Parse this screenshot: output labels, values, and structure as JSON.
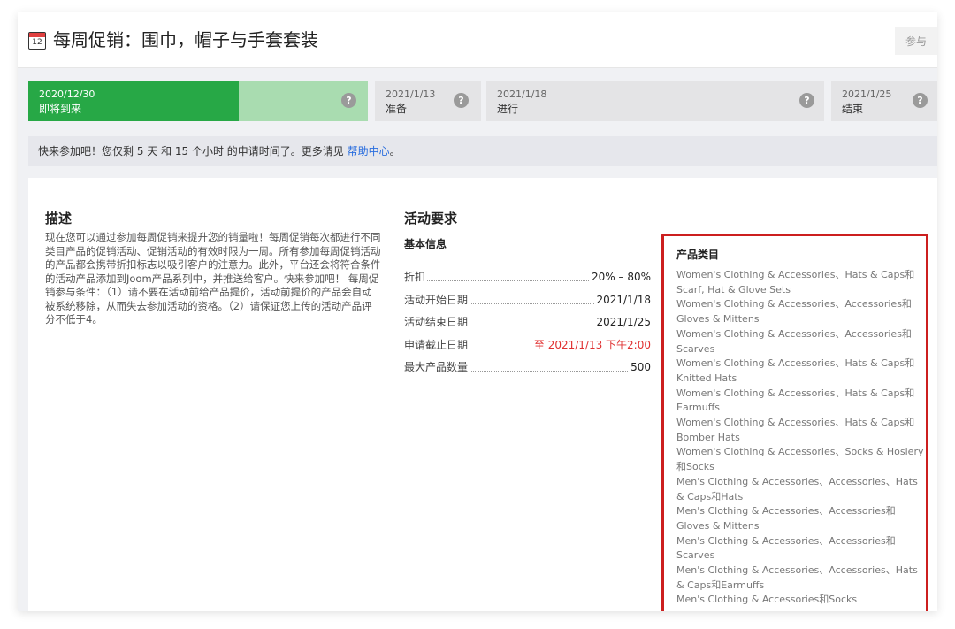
{
  "header": {
    "calendar_day": "12",
    "title": "每周促销：围巾，帽子与手套套装",
    "join_label": "参与"
  },
  "timeline": {
    "stages": [
      {
        "date": "2020/12/30",
        "label": "即将到来",
        "progress": 0.62
      },
      {
        "date": "2021/1/13",
        "label": "准备"
      },
      {
        "date": "2021/1/18",
        "label": "进行"
      },
      {
        "date": "2021/1/25",
        "label": "结束"
      }
    ],
    "help_glyph": "?"
  },
  "notice": {
    "text": "快来参加吧！您仅剩 5 天 和 15 个小时 的申请时间了。更多请见 ",
    "link_label": "帮助中心",
    "suffix": "。",
    "link_color": "#2a6ede"
  },
  "description": {
    "title": "描述",
    "text": "现在您可以通过参加每周促销来提升您的销量啦！每周促销每次都进行不同类目产品的促销活动、促销活动的有效时限为一周。所有参加每周促销活动的产品都会携带折扣标志以吸引客户的注意力。此外，平台还会将符合条件的活动产品添加到Joom产品系列中，并推送给客户。快来参加吧！ 每周促销参与条件：（1）请不要在活动前给产品提价，活动前提价的产品会自动被系统移除，从而失去参加活动的资格。（2）请保证您上传的活动产品评分不低于4。"
  },
  "requirements": {
    "title": "活动要求",
    "basic_title": "基本信息",
    "rows": [
      {
        "key": "折扣",
        "value": "20% – 80%"
      },
      {
        "key": "活动开始日期",
        "value": "2021/1/18"
      },
      {
        "key": "活动结束日期",
        "value": "2021/1/25"
      },
      {
        "key": "申请截止日期",
        "value": "至 2021/1/13 下午2:00",
        "highlight": true
      },
      {
        "key": "最大产品数量",
        "value": "500"
      }
    ]
  },
  "categories": {
    "title": "产品类目",
    "items": [
      "Women's Clothing & Accessories、Hats & Caps和Scarf, Hat & Glove Sets",
      "Women's Clothing & Accessories、Accessories和Gloves & Mittens",
      "Women's Clothing & Accessories、Accessories和Scarves",
      "Women's Clothing & Accessories、Hats & Caps和Knitted Hats",
      "Women's Clothing & Accessories、Hats & Caps和Earmuffs",
      "Women's Clothing & Accessories、Hats & Caps和Bomber Hats",
      "Women's Clothing & Accessories、Socks & Hosiery和Socks",
      "Men's Clothing & Accessories、Accessories、Hats & Caps和Hats",
      "Men's Clothing & Accessories、Accessories和Gloves & Mittens",
      "Men's Clothing & Accessories、Accessories和Scarves",
      "Men's Clothing & Accessories、Accessories、Hats & Caps和Earmuffs",
      "Men's Clothing & Accessories和Socks"
    ],
    "highlight_color": "#cc1f1f"
  },
  "colors": {
    "active_green": "#27a846",
    "active_light": "#a9dcb0",
    "deadline_red": "#e03030"
  }
}
